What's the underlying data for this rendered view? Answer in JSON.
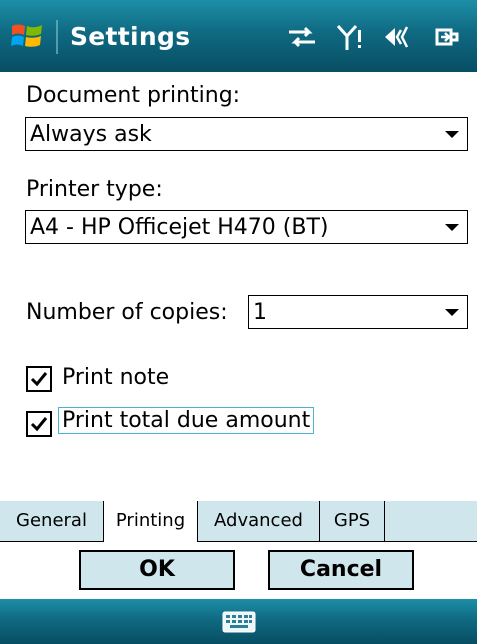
{
  "title_bar": {
    "title": "Settings",
    "icons": [
      "windows-start-icon",
      "connectivity-icon",
      "signal-icon",
      "volume-icon",
      "battery-icon"
    ]
  },
  "document_printing": {
    "label": "Document printing:",
    "value": "Always ask"
  },
  "printer_type": {
    "label": "Printer type:",
    "value": "A4 - HP Officejet H470 (BT)"
  },
  "number_of_copies": {
    "label": "Number of copies:",
    "value": "1"
  },
  "options": {
    "print_note": {
      "label": "Print note",
      "checked": true
    },
    "print_total_due": {
      "label": "Print total due amount",
      "checked": true
    }
  },
  "tabs": [
    {
      "label": "General",
      "active": false
    },
    {
      "label": "Printing",
      "active": true
    },
    {
      "label": "Advanced",
      "active": false
    },
    {
      "label": "GPS",
      "active": false
    }
  ],
  "buttons": {
    "ok": "OK",
    "cancel": "Cancel"
  },
  "bottom_bar": {
    "icon": "keyboard-icon"
  },
  "colors": {
    "title_bar": "#0f6a82",
    "tab_inactive": "#cfe6ec",
    "focus": "#46b6cf"
  }
}
